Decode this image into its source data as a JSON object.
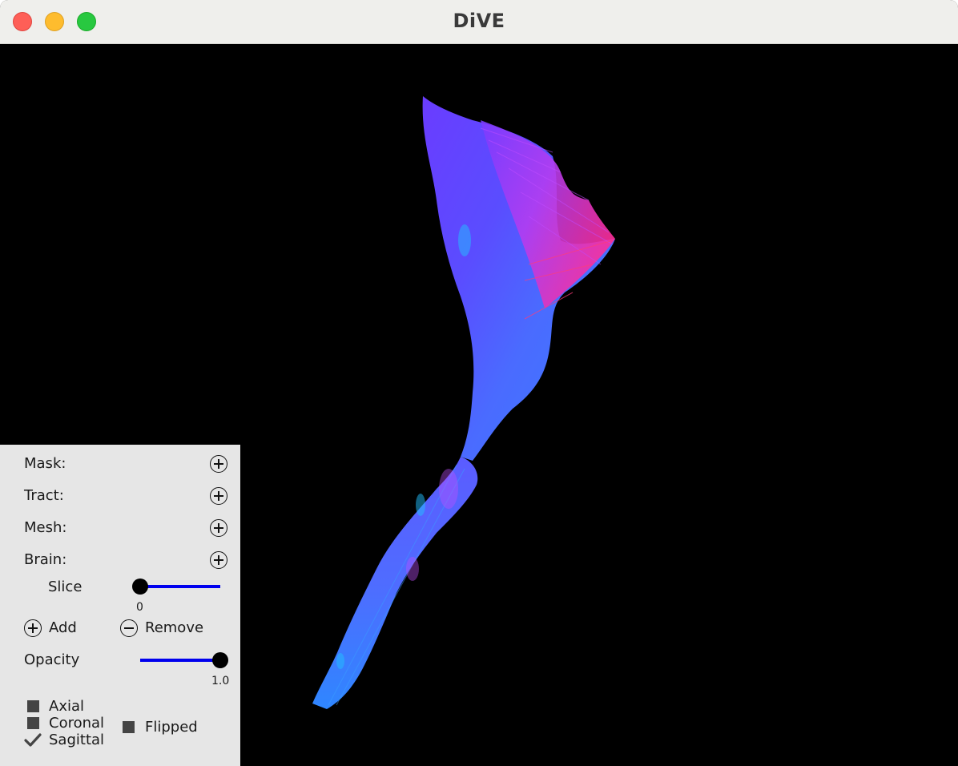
{
  "window": {
    "title": "DiVE"
  },
  "panel": {
    "rows": [
      {
        "label": "Mask:"
      },
      {
        "label": "Tract:"
      },
      {
        "label": "Mesh:"
      },
      {
        "label": "Brain:"
      }
    ],
    "slice": {
      "label": "Slice",
      "value": "0"
    },
    "add_label": "Add",
    "remove_label": "Remove",
    "opacity": {
      "label": "Opacity",
      "value": "1.0"
    },
    "planes": [
      {
        "label": "Axial",
        "checked": false
      },
      {
        "label": "Coronal",
        "checked": false
      },
      {
        "label": "Sagittal",
        "checked": true
      }
    ],
    "flipped": {
      "label": "Flipped",
      "checked": false
    }
  },
  "colors": {
    "slider": "#0000ee",
    "panel_bg": "#e6e6e6",
    "viewport_bg": "#000000"
  },
  "icons": [
    "add-circle-icon",
    "remove-circle-icon",
    "checkmark-icon"
  ]
}
